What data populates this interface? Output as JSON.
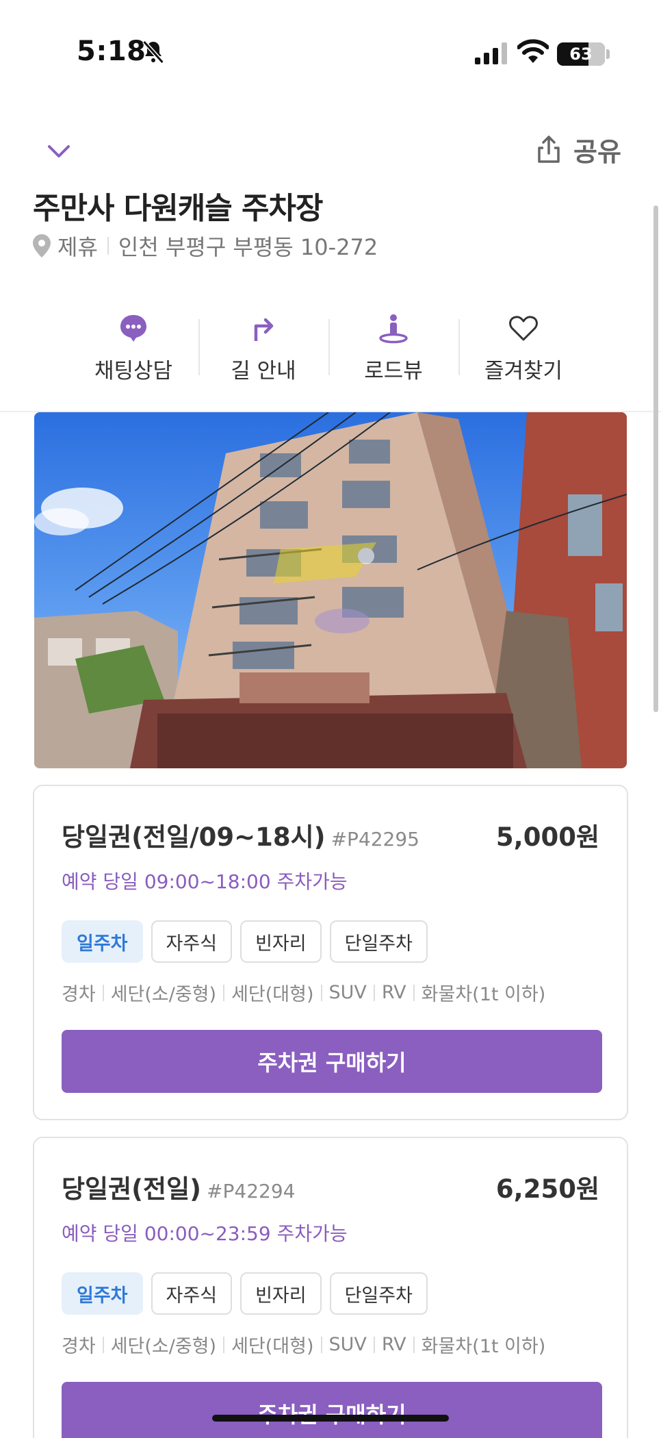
{
  "status_bar": {
    "time": "5:18",
    "battery": "63",
    "icons": [
      "bell-slash-icon",
      "signal-icon",
      "wifi-icon",
      "battery-icon"
    ]
  },
  "header": {
    "share_label": "공유"
  },
  "parking": {
    "name": "주만사 다원캐슬 주차장",
    "tag": "제휴",
    "address": "인천 부평구 부평동 10-272"
  },
  "actions": [
    {
      "label": "채팅상담",
      "icon": "chat-icon"
    },
    {
      "label": "길 안내",
      "icon": "directions-icon"
    },
    {
      "label": "로드뷰",
      "icon": "road-view-icon"
    },
    {
      "label": "즐겨찾기",
      "icon": "heart-icon"
    }
  ],
  "tickets": [
    {
      "name": "당일권(전일/09~18시)",
      "code": "#P42295",
      "price": "5,000원",
      "desc": "예약 당일 09:00~18:00 주차가능",
      "chips": [
        "일주차",
        "자주식",
        "빈자리",
        "단일주차"
      ],
      "vehicles": [
        "경차",
        "세단(소/중형)",
        "세단(대형)",
        "SUV",
        "RV",
        "화물차(1t 이하)"
      ],
      "button": "주차권 구매하기"
    },
    {
      "name": "당일권(전일)",
      "code": "#P42294",
      "price": "6,250원",
      "desc": "예약 당일 00:00~23:59 주차가능",
      "chips": [
        "일주차",
        "자주식",
        "빈자리",
        "단일주차"
      ],
      "vehicles": [
        "경차",
        "세단(소/중형)",
        "세단(대형)",
        "SUV",
        "RV",
        "화물차(1t 이하)"
      ],
      "button": "주차권 구매하기"
    }
  ],
  "colors": {
    "accent": "#8a5fc0",
    "chip_primary_bg": "#e6f0fb",
    "chip_primary_text": "#2e79d6"
  }
}
